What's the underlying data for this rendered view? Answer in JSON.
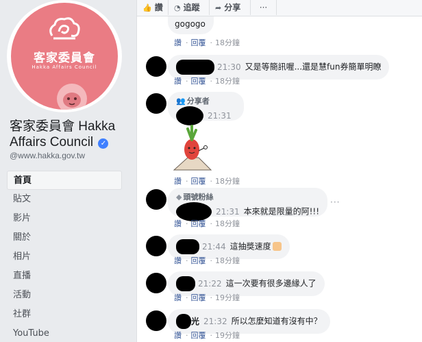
{
  "page": {
    "logo_zh": "客家委員會",
    "logo_en": "Hakka Affairs Council",
    "name": "客家委員會 Hakka Affairs Council",
    "handle": "@www.hakka.gov.tw"
  },
  "nav": [
    {
      "label": "首頁",
      "active": true
    },
    {
      "label": "貼文"
    },
    {
      "label": "影片"
    },
    {
      "label": "關於"
    },
    {
      "label": "相片"
    },
    {
      "label": "直播"
    },
    {
      "label": "活動"
    },
    {
      "label": "社群"
    },
    {
      "label": "YouTube"
    }
  ],
  "actions": {
    "like": "讚",
    "follow": "追蹤",
    "share": "分享",
    "more": "···"
  },
  "comment_meta": {
    "like": "讚",
    "reply": "回覆"
  },
  "comments": [
    {
      "text": "gogogo",
      "time": "",
      "age": "18分鐘"
    },
    {
      "time": "21:30",
      "text": "又是等簡訊喔...還是慧fun券簡單明瞭",
      "age": "18分鐘"
    },
    {
      "badge": "分享者",
      "time": "21:31",
      "text": "",
      "age": "18分鐘"
    },
    {
      "badge": "頭號粉絲",
      "time": "21:31",
      "text": "本來就是限量的阿!!!",
      "age": "18分鐘"
    },
    {
      "time": "21:44",
      "text": "這抽獎速度",
      "age": "18分鐘"
    },
    {
      "time": "21:22",
      "text": "這一次要有很多邊緣人了",
      "age": "19分鐘"
    },
    {
      "name_fragment": "光",
      "time": "21:32",
      "text": "所以怎麼知道有沒有中？",
      "age": "19分鐘"
    }
  ]
}
